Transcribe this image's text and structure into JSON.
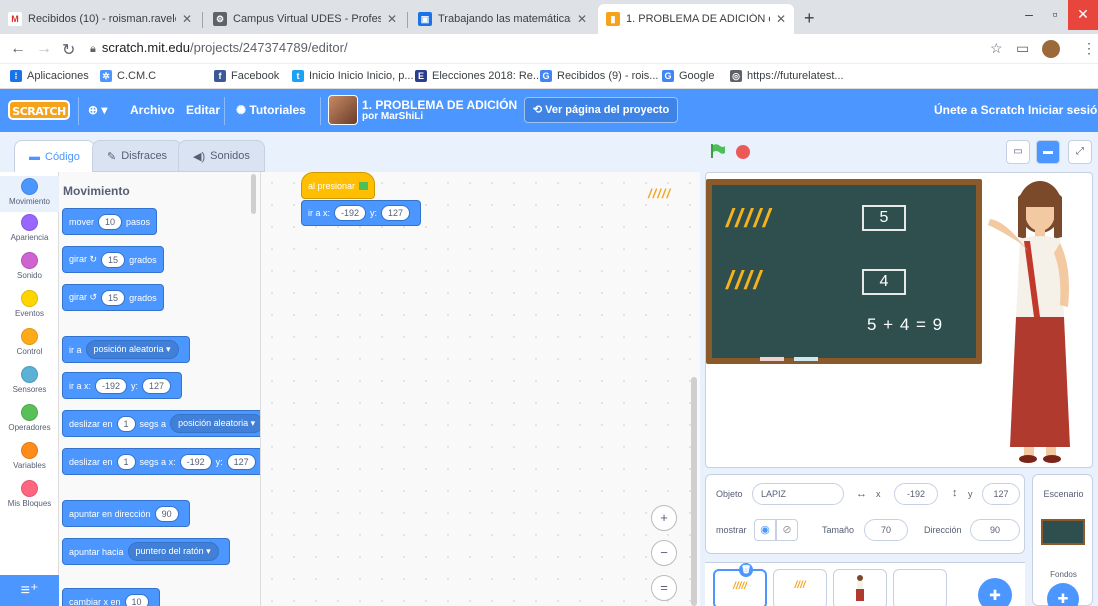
{
  "browser": {
    "tabs": [
      {
        "title": "Recibidos (10) - roisman.ravelo@",
        "favicon": "M",
        "color": "#d93025"
      },
      {
        "title": "Campus Virtual UDES - Profesor",
        "favicon": "⚙",
        "color": "#5f6368"
      },
      {
        "title": "Trabajando las matemáticas con",
        "favicon": "▣",
        "color": "#1a73e8"
      },
      {
        "title": "1. PROBLEMA DE ADICIÓN on Sc",
        "favicon": "▮",
        "color": "#f7a21b"
      }
    ],
    "new_tab": "+",
    "url_host": "scratch.mit.edu",
    "url_path": "/projects/247374789/editor/",
    "bookmarks": [
      {
        "label": "Aplicaciones",
        "icon": "apps-grid-icon",
        "color": "#1a73e8"
      },
      {
        "label": "C.CM.C",
        "icon": "gear-icon",
        "color": "#4c97ff"
      },
      {
        "label": "Facebook",
        "icon": "facebook-icon",
        "color": "#3b5998"
      },
      {
        "label": "Inicio Inicio Inicio, p...",
        "icon": "twitter-icon",
        "color": "#1da1f2"
      },
      {
        "label": "Elecciones 2018: Re...",
        "icon": "ee-icon",
        "color": "#2a3d8f"
      },
      {
        "label": "Recibidos (9) - rois...",
        "icon": "google-icon",
        "color": "#4285f4"
      },
      {
        "label": "Google",
        "icon": "google-icon",
        "color": "#4285f4"
      },
      {
        "label": "https://futurelatest...",
        "icon": "globe-icon",
        "color": "#5f6368"
      }
    ]
  },
  "menubar": {
    "logo": "SCRATCH",
    "language": "⊕ ▾",
    "archivo": "Archivo",
    "editar": "Editar",
    "tutoriales": "Tutoriales",
    "project_title": "1. PROBLEMA DE ADICIÓN",
    "project_author": "por MarShiLi",
    "see_project": "Ver página del proyecto",
    "join": "Únete a Scratch",
    "signin": "Iniciar sesión"
  },
  "editor_tabs": {
    "code": "Código",
    "costumes": "Disfraces",
    "sounds": "Sonidos"
  },
  "categories": [
    {
      "label": "Movimiento",
      "color": "#4c97ff"
    },
    {
      "label": "Apariencia",
      "color": "#9966ff"
    },
    {
      "label": "Sonido",
      "color": "#cf63cf"
    },
    {
      "label": "Eventos",
      "color": "#ffd500"
    },
    {
      "label": "Control",
      "color": "#ffab19"
    },
    {
      "label": "Sensores",
      "color": "#5cb1d6"
    },
    {
      "label": "Operadores",
      "color": "#59c059"
    },
    {
      "label": "Variables",
      "color": "#ff8c1a"
    },
    {
      "label": "Mis Bloques",
      "color": "#ff6680"
    }
  ],
  "palette": {
    "title": "Movimiento",
    "blocks": {
      "move": {
        "pre": "mover",
        "val": "10",
        "post": "pasos"
      },
      "turn_right": {
        "pre": "girar ↻",
        "val": "15",
        "post": "grados"
      },
      "turn_left": {
        "pre": "girar ↺",
        "val": "15",
        "post": "grados"
      },
      "goto_random": {
        "pre": "ir a",
        "drop": "posición aleatoria ▾"
      },
      "goto_xy": {
        "pre": "ir a x:",
        "x": "-192",
        "ymid": "y:",
        "y": "127"
      },
      "glide_random": {
        "pre": "deslizar en",
        "val": "1",
        "mid": "segs a",
        "drop": "posición aleatoria ▾"
      },
      "glide_xy": {
        "pre": "deslizar en",
        "val": "1",
        "mid": "segs a x:",
        "x": "-192",
        "ymid": "y:",
        "y": "127"
      },
      "point_dir": {
        "pre": "apuntar en dirección",
        "val": "90"
      },
      "point_towards": {
        "pre": "apuntar hacia",
        "drop": "puntero del ratón ▾"
      },
      "change_x": {
        "pre": "cambiar x en",
        "val": "10"
      }
    }
  },
  "script": {
    "hat": "al presionar",
    "goto_pre": "ir a x:",
    "x": "-192",
    "ymid": "y:",
    "y": "127",
    "sprite_preview": "/////"
  },
  "zoom": {
    "in": "+",
    "out": "−",
    "reset": "="
  },
  "stage": {
    "pencils_top": "/////",
    "pencils_bottom": "////",
    "box_top": "5",
    "box_bottom": "4",
    "equation": "5 + 4 = 9"
  },
  "sprite_info": {
    "objeto_label": "Objeto",
    "objeto_value": "LAPIZ",
    "x_label": "x",
    "x_value": "-192",
    "y_label": "y",
    "y_value": "127",
    "mostrar_label": "mostrar",
    "tamano_label": "Tamaño",
    "tamano_value": "70",
    "direccion_label": "Dirección",
    "direccion_value": "90"
  },
  "sprites": {
    "s1": "/////",
    "s2": "////",
    "s3": "",
    "s4": ""
  },
  "scenario": {
    "title": "Escenario",
    "backdrops": "Fondos"
  }
}
